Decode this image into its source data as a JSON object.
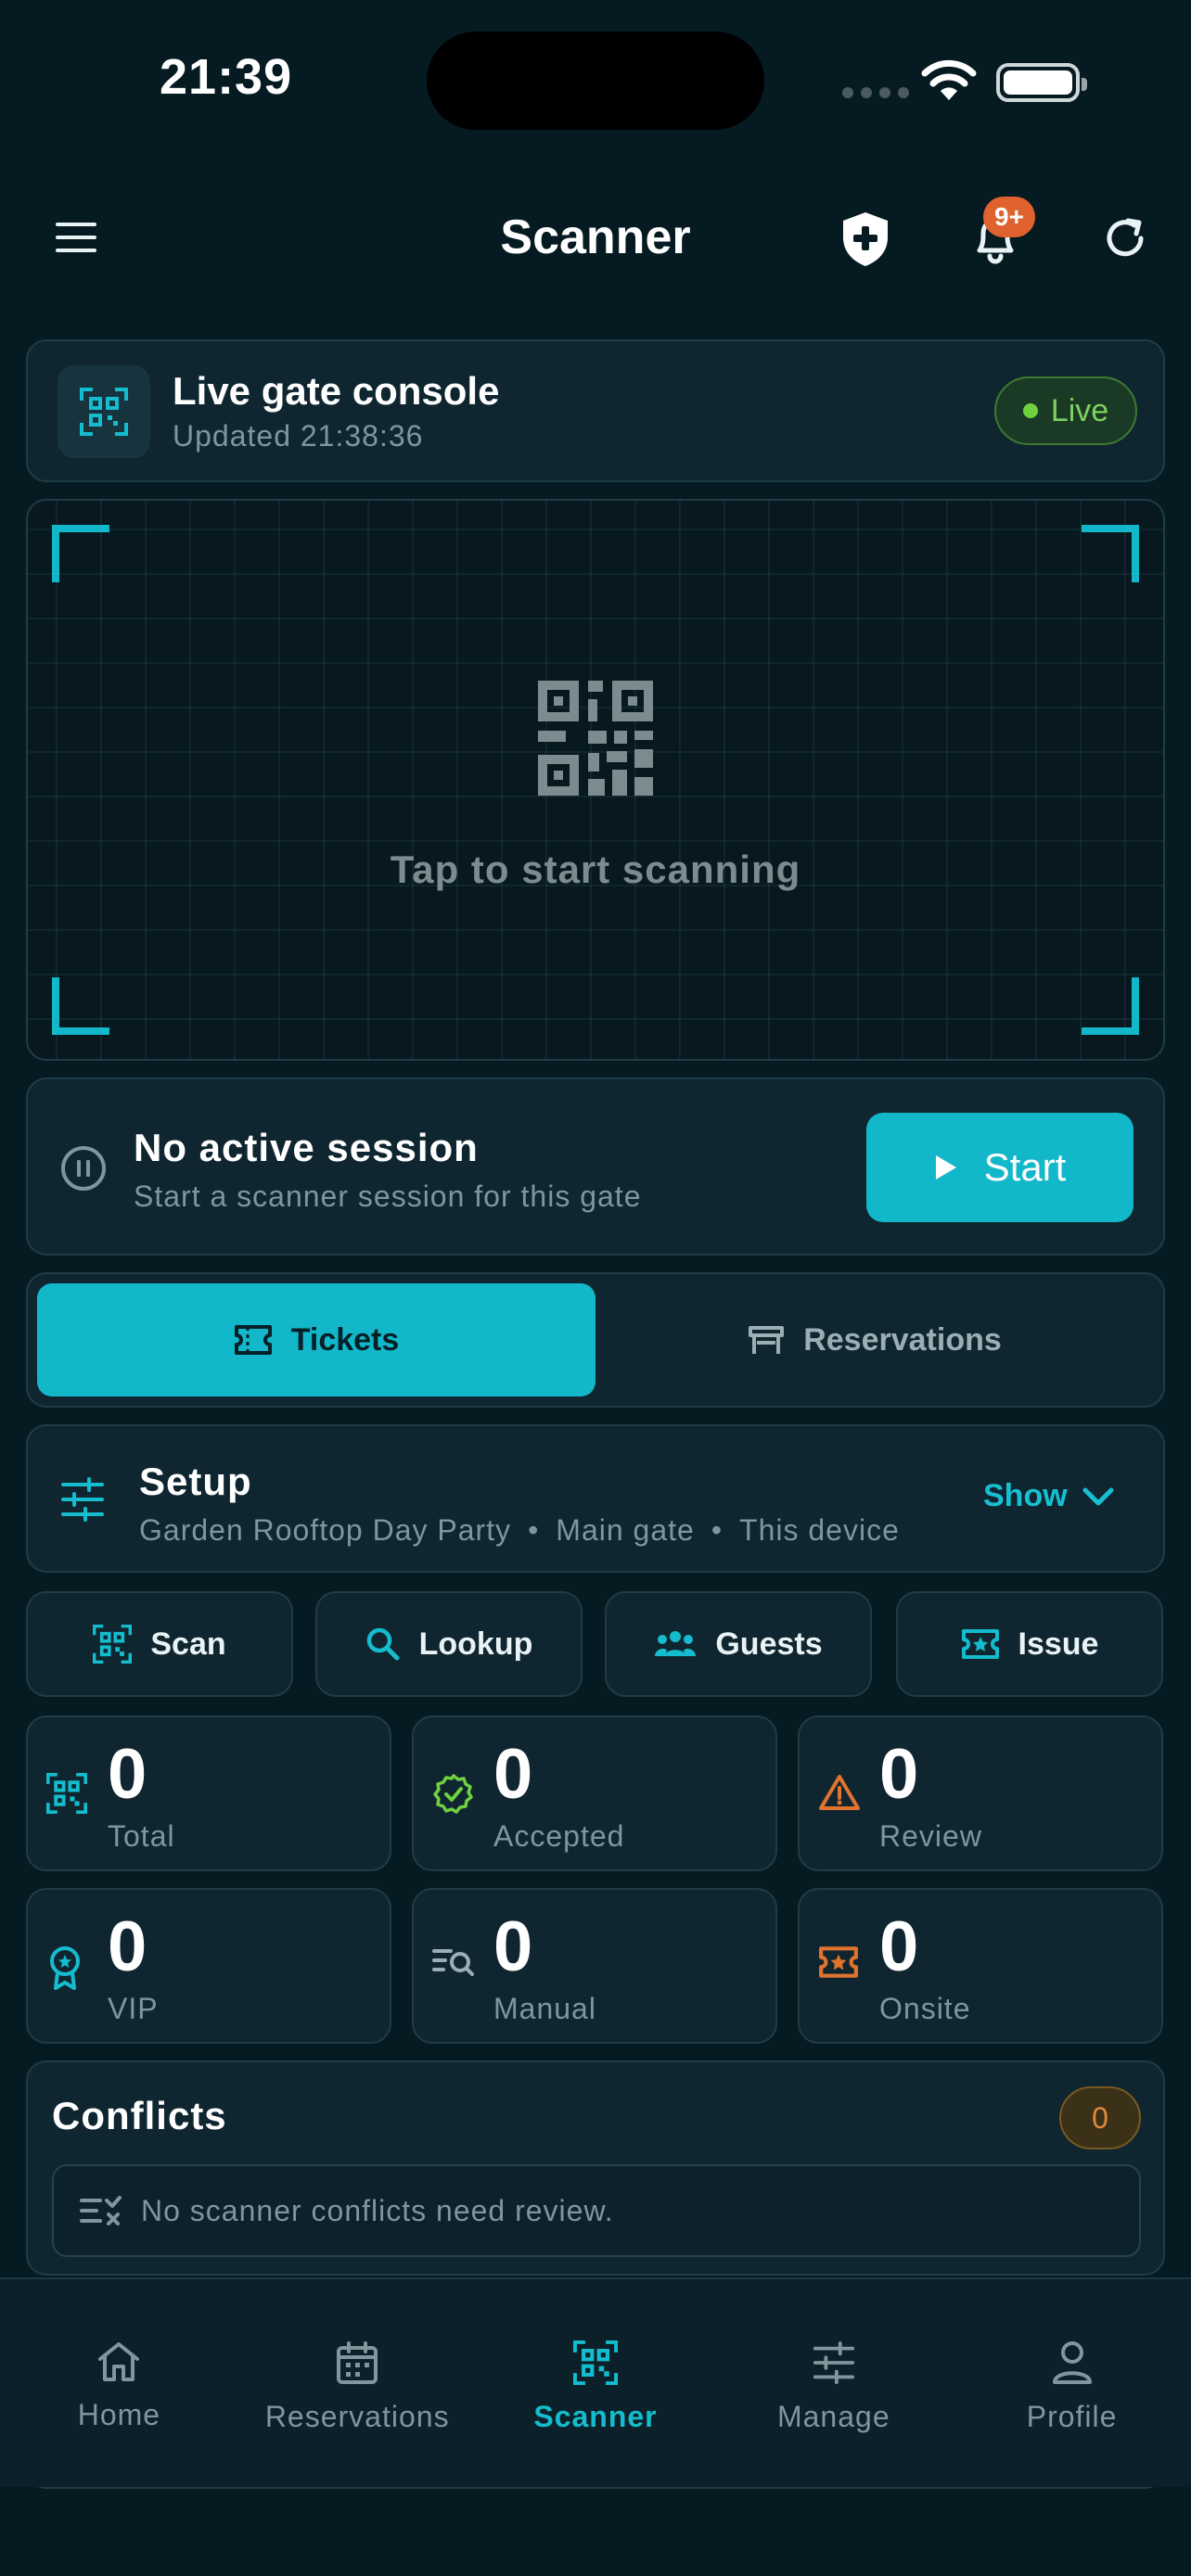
{
  "status_bar": {
    "time": "21:39"
  },
  "header": {
    "title": "Scanner",
    "notification_badge": "9+"
  },
  "console": {
    "title": "Live gate console",
    "updated": "Updated 21:38:36",
    "live_label": "Live"
  },
  "scanner": {
    "hint": "Tap to start scanning"
  },
  "session": {
    "title": "No active session",
    "subtitle": "Start a scanner session for this gate",
    "start_label": "Start"
  },
  "segments": [
    {
      "label": "Tickets",
      "active": true
    },
    {
      "label": "Reservations",
      "active": false
    }
  ],
  "setup": {
    "title": "Setup",
    "event": "Garden Rooftop Day Party",
    "gate": "Main gate",
    "device": "This device",
    "separator": "•",
    "toggle_label": "Show"
  },
  "actions": [
    {
      "label": "Scan",
      "icon": "qr-scan-icon"
    },
    {
      "label": "Lookup",
      "icon": "search-icon"
    },
    {
      "label": "Guests",
      "icon": "users-icon"
    },
    {
      "label": "Issue",
      "icon": "ticket-star-icon"
    }
  ],
  "stats": [
    {
      "value": "0",
      "label": "Total",
      "icon": "qr-scan-icon",
      "color": "#14bccd"
    },
    {
      "value": "0",
      "label": "Accepted",
      "icon": "check-badge-icon",
      "color": "#6fd13f"
    },
    {
      "value": "0",
      "label": "Review",
      "icon": "warning-icon",
      "color": "#e0732e"
    },
    {
      "value": "0",
      "label": "VIP",
      "icon": "award-icon",
      "color": "#14bccd"
    },
    {
      "value": "0",
      "label": "Manual",
      "icon": "list-search-icon",
      "color": "#9aaeb4"
    },
    {
      "value": "0",
      "label": "Onsite",
      "icon": "ticket-star-icon",
      "color": "#e0732e"
    }
  ],
  "conflicts": {
    "title": "Conflicts",
    "count": "0",
    "empty_message": "No scanner conflicts need review."
  },
  "nav": [
    {
      "label": "Home",
      "icon": "home-icon",
      "active": false
    },
    {
      "label": "Reservations",
      "icon": "calendar-icon",
      "active": false
    },
    {
      "label": "Scanner",
      "icon": "qr-scan-icon",
      "active": true
    },
    {
      "label": "Manage",
      "icon": "sliders-icon",
      "active": false
    },
    {
      "label": "Profile",
      "icon": "user-icon",
      "active": false
    }
  ],
  "colors": {
    "background": "#061a22",
    "card": "#0f2630",
    "accent": "#12b8c9",
    "live_green": "#6fd13f",
    "warning_orange": "#e0732e"
  }
}
